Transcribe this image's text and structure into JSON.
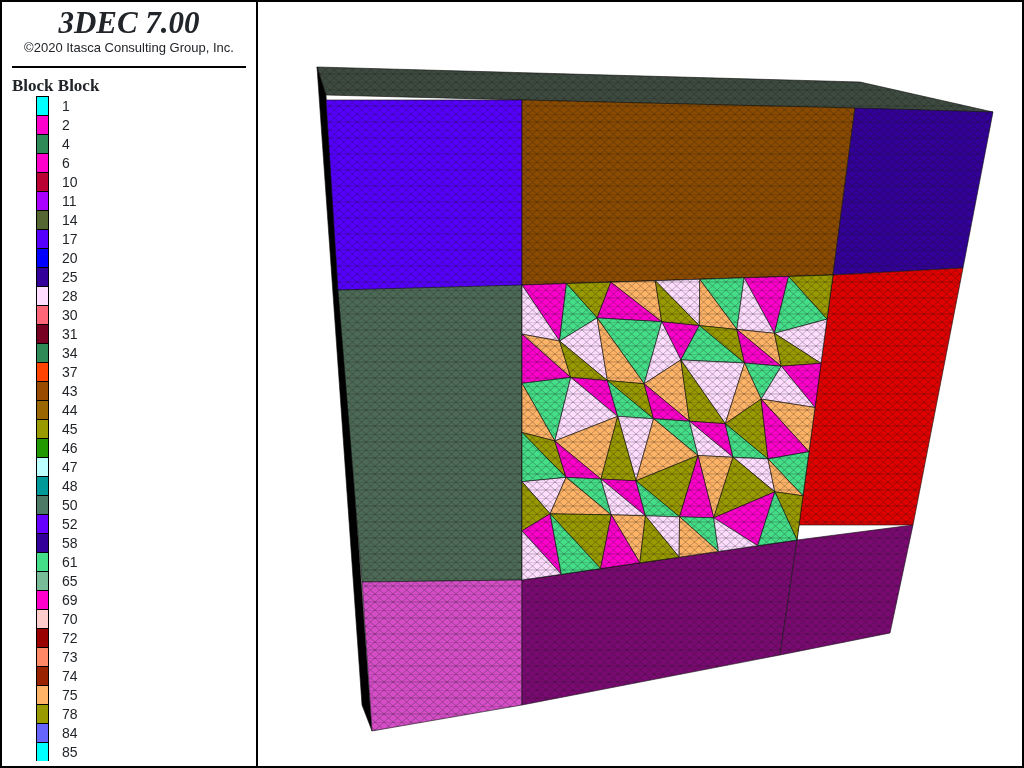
{
  "title": "3DEC 7.00",
  "copyright": "©2020 Itasca Consulting Group, Inc.",
  "legend": {
    "title": "Block Block",
    "items": [
      {
        "label": "1",
        "color": "#00ffff"
      },
      {
        "label": "2",
        "color": "#ff00cc"
      },
      {
        "label": "4",
        "color": "#2e8b57"
      },
      {
        "label": "6",
        "color": "#ff00cc"
      },
      {
        "label": "10",
        "color": "#bb0033"
      },
      {
        "label": "11",
        "color": "#aa00ff"
      },
      {
        "label": "14",
        "color": "#556633"
      },
      {
        "label": "17",
        "color": "#5500ff"
      },
      {
        "label": "20",
        "color": "#0000ff"
      },
      {
        "label": "25",
        "color": "#330099"
      },
      {
        "label": "28",
        "color": "#ffddff"
      },
      {
        "label": "30",
        "color": "#ff6677"
      },
      {
        "label": "31",
        "color": "#770022"
      },
      {
        "label": "34",
        "color": "#2e8b57"
      },
      {
        "label": "37",
        "color": "#ff4400"
      },
      {
        "label": "43",
        "color": "#994c00"
      },
      {
        "label": "44",
        "color": "#996600"
      },
      {
        "label": "45",
        "color": "#999900"
      },
      {
        "label": "46",
        "color": "#229900"
      },
      {
        "label": "47",
        "color": "#bbffff"
      },
      {
        "label": "48",
        "color": "#009999"
      },
      {
        "label": "50",
        "color": "#4d7a66"
      },
      {
        "label": "52",
        "color": "#6600ff"
      },
      {
        "label": "58",
        "color": "#330099"
      },
      {
        "label": "61",
        "color": "#44dd88"
      },
      {
        "label": "65",
        "color": "#77bb99"
      },
      {
        "label": "69",
        "color": "#ff00cc"
      },
      {
        "label": "70",
        "color": "#ffcccc"
      },
      {
        "label": "72",
        "color": "#990000"
      },
      {
        "label": "73",
        "color": "#ff8866"
      },
      {
        "label": "74",
        "color": "#992200"
      },
      {
        "label": "75",
        "color": "#ffb366"
      },
      {
        "label": "78",
        "color": "#999900"
      },
      {
        "label": "84",
        "color": "#6666ff"
      },
      {
        "label": "85",
        "color": "#00ffff"
      }
    ]
  }
}
